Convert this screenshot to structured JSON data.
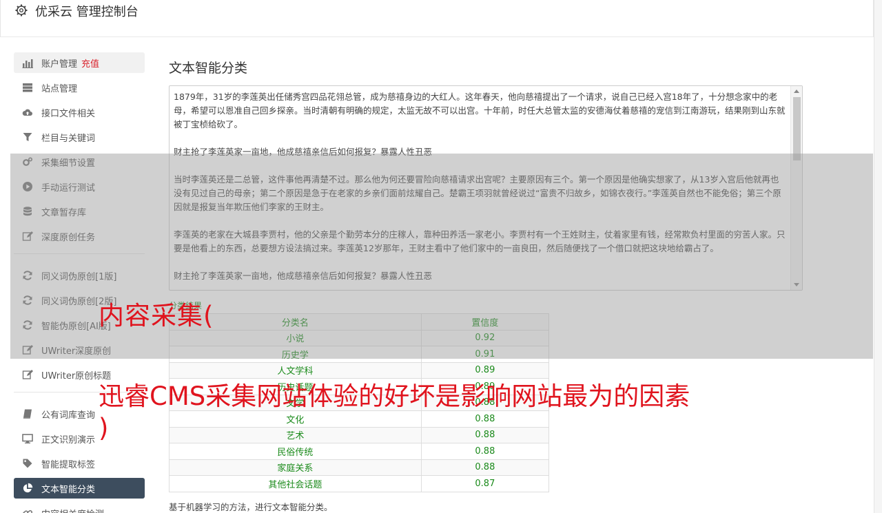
{
  "header": {
    "title": "优采云 管理控制台"
  },
  "sidebar": {
    "group1": [
      {
        "label": "账户管理",
        "badge": "充值",
        "icon": "bar-chart-icon"
      },
      {
        "label": "站点管理",
        "icon": "server-icon"
      },
      {
        "label": "接口文件相关",
        "icon": "cloud-upload-icon"
      },
      {
        "label": "栏目与关键词",
        "icon": "filter-icon"
      },
      {
        "label": "采集细节设置",
        "icon": "gears-icon"
      },
      {
        "label": "手动运行测试",
        "icon": "play-circle-icon"
      },
      {
        "label": "文章暂存库",
        "icon": "database-icon"
      },
      {
        "label": "深度原创任务",
        "icon": "edit-icon"
      }
    ],
    "group2": [
      {
        "label": "同义词伪原创[1版]",
        "icon": "refresh-icon"
      },
      {
        "label": "同义词伪原创[2版]",
        "icon": "refresh-icon"
      },
      {
        "label": "智能伪原创[AI版]",
        "icon": "refresh-icon"
      },
      {
        "label": "UWriter深度原创",
        "icon": "edit-icon"
      },
      {
        "label": "UWriter原创标题",
        "icon": "edit-icon"
      }
    ],
    "group3": [
      {
        "label": "公有词库查询",
        "icon": "book-icon"
      },
      {
        "label": "正文识别演示",
        "icon": "monitor-icon"
      },
      {
        "label": "智能提取标签",
        "icon": "tag-icon"
      },
      {
        "label": "文本智能分类",
        "icon": "pie-chart-icon"
      },
      {
        "label": "内容相关度检测",
        "icon": "link-icon"
      }
    ]
  },
  "main": {
    "title": "文本智能分类",
    "article": [
      "1879年，31岁的李莲英出任储秀宫四品花翎总管，成为慈禧身边的大红人。这年春天，他向慈禧提出了一个请求，说自己已经入宫18年了，十分想念家中的老母，希望可以恩准自己回乡探亲。当时清朝有明确的规定，太监无故不可以出宫。十年前，时任大总管太监的安德海仗着慈禧的宠信到江南游玩，结果刚到山东就被丁宝桢给砍了。",
      "财主抢了李莲英家一亩地，他成慈禧亲信后如何报复？暴露人性丑恶",
      "当时李莲英还是二总管，这件事他再清楚不过。那么他为何还要冒险向慈禧请求出宫呢？主要原因有三个。第一个原因是他确实想家了，从13岁入宫后他就再也没有见过自己的母亲；第二个原因是急于在老家的乡亲们面前炫耀自己。楚霸王项羽就曾经说过“富贵不归故乡，如锦衣夜行。”李莲英自然也不能免俗；第三个原因就是报复当年欺压他们李家的王财主。",
      "李莲英的老家在大城县李贾村，他的父亲是个勤劳本分的庄稼人，靠种田养活一家老小。李贾村有一个王姓财主，仗着家里有钱，经常欺负村里面的穷苦人家。只要是他看上的东西，总要想方设法搞过来。李莲英12岁那年，王财主看中了他们家中的一亩良田，然后随便找了一个借口就把这块地给霸占了。",
      "财主抢了李莲英家一亩地，他成慈禧亲信后如何报复？暴露人性丑恶"
    ],
    "result_label": "分类结果",
    "table": {
      "headers": [
        "分类名",
        "置信度"
      ],
      "rows": [
        [
          "小说",
          "0.92"
        ],
        [
          "历史学",
          "0.91"
        ],
        [
          "人文学科",
          "0.89"
        ],
        [
          "历史话题",
          "0.89"
        ],
        [
          "文学",
          "0.88"
        ],
        [
          "文化",
          "0.88"
        ],
        [
          "艺术",
          "0.88"
        ],
        [
          "民俗传统",
          "0.88"
        ],
        [
          "家庭关系",
          "0.88"
        ],
        [
          "其他社会话题",
          "0.87"
        ]
      ]
    },
    "footnote": "基于机器学习的方法，进行文本智能分类。"
  },
  "watermark": {
    "line1": "内容采集(",
    "line2": "迅睿CMS采集网站体验的好坏是影响网站最为的因素",
    "line3": ")"
  },
  "colors": {
    "accent_red": "#e0141e",
    "active_nav": "#3d4d5e",
    "result_green": "#1a8a1a"
  }
}
